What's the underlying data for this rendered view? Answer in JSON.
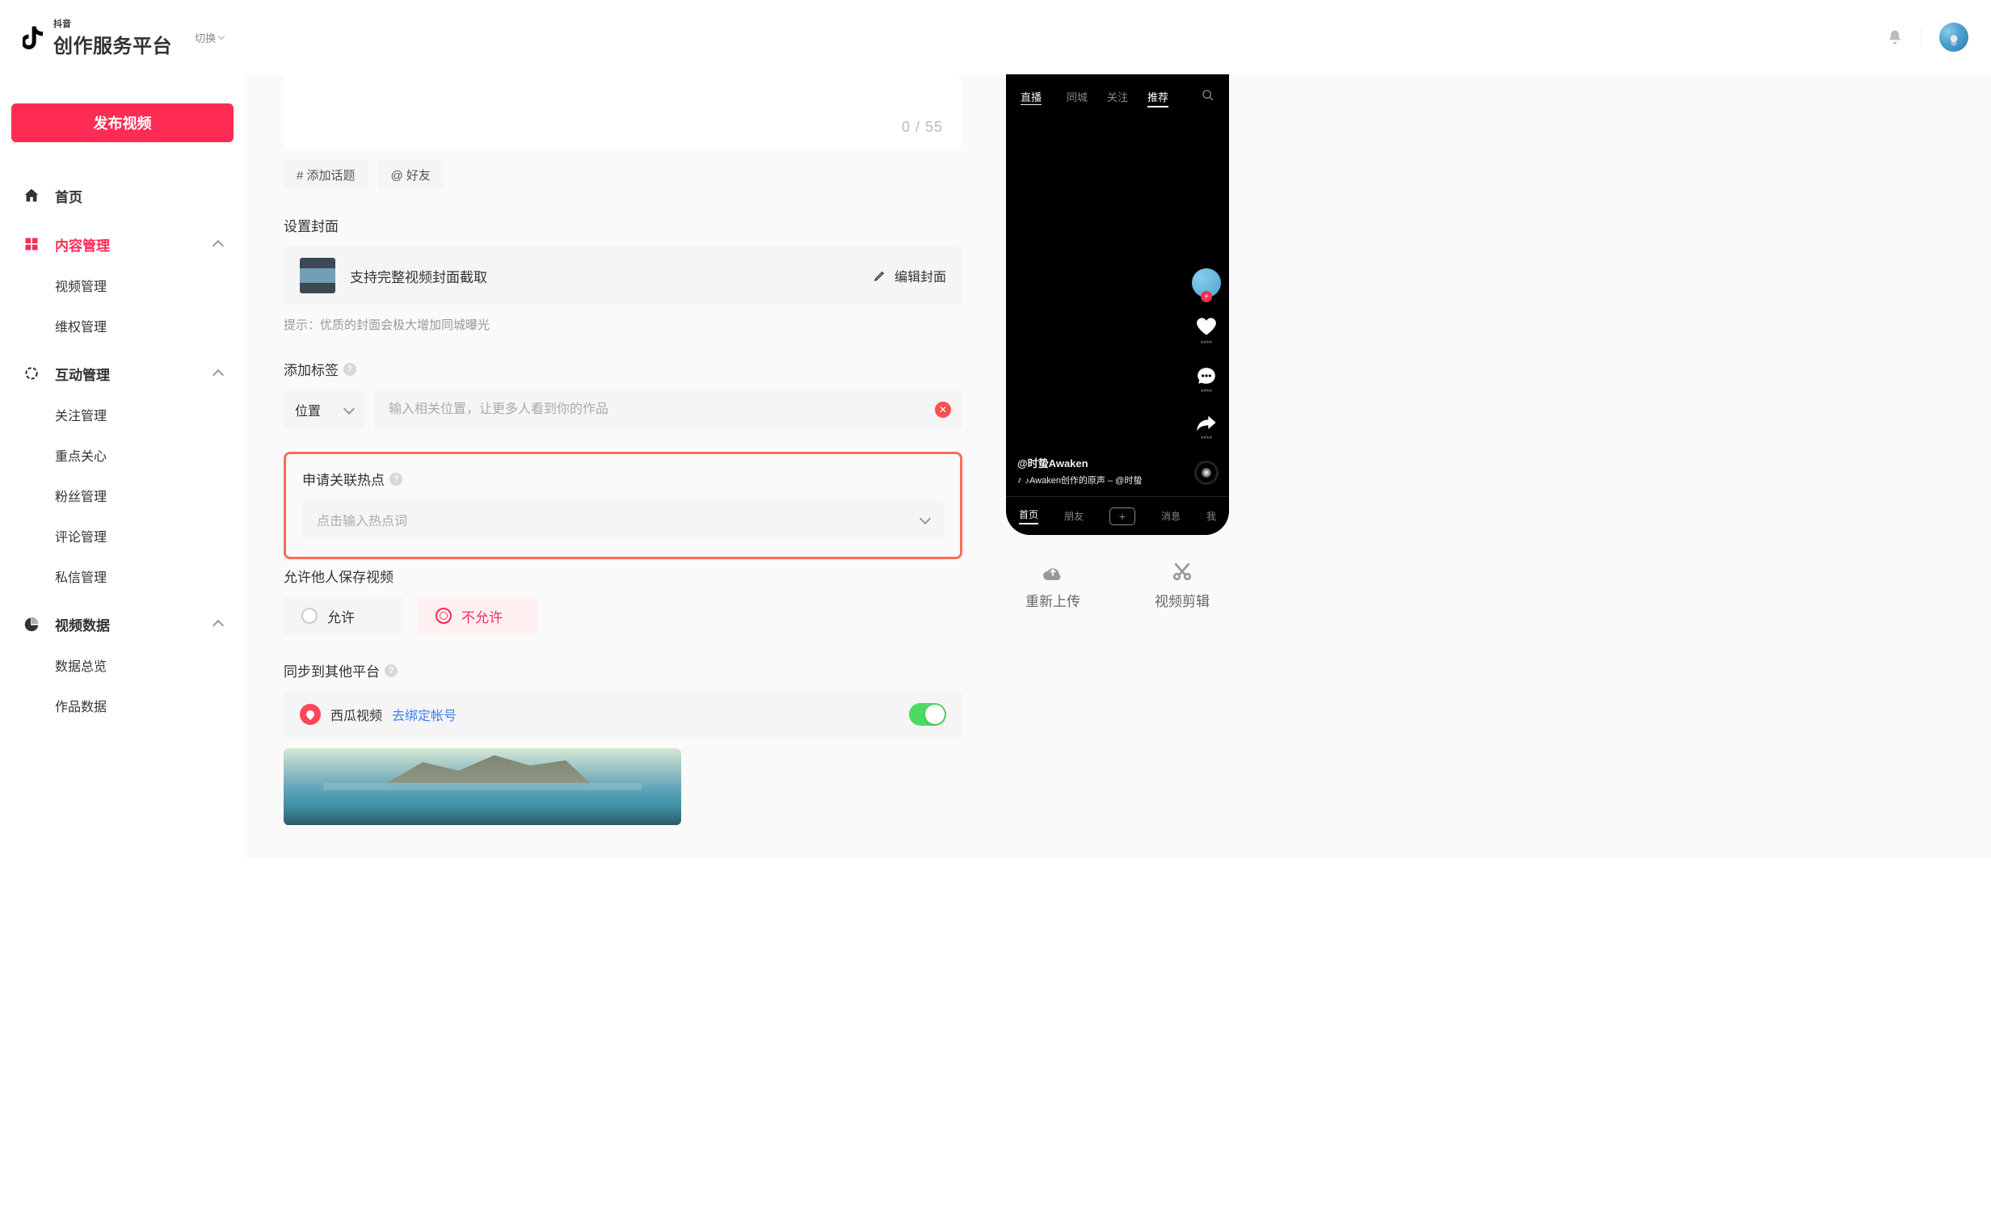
{
  "header": {
    "logo_small": "抖音",
    "logo_big": "创作服务平台",
    "switch": "切换"
  },
  "sidebar": {
    "publish": "发布视频",
    "home": "首页",
    "content": {
      "label": "内容管理",
      "items": [
        "视频管理",
        "维权管理"
      ]
    },
    "interact": {
      "label": "互动管理",
      "items": [
        "关注管理",
        "重点关心",
        "粉丝管理",
        "评论管理",
        "私信管理"
      ]
    },
    "data": {
      "label": "视频数据",
      "items": [
        "数据总览",
        "作品数据"
      ]
    }
  },
  "form": {
    "char_count": "0 / 55",
    "topic_btn": "# 添加话题",
    "mention_btn": "@ 好友",
    "cover": {
      "title": "设置封面",
      "desc": "支持完整视频封面截取",
      "edit": "编辑封面",
      "hint": "提示：优质的封面会极大增加同城曝光"
    },
    "tags": {
      "title": "添加标签",
      "select": "位置",
      "placeholder": "输入相关位置，让更多人看到你的作品"
    },
    "hotspot": {
      "title": "申请关联热点",
      "placeholder": "点击输入热点词"
    },
    "save_allow": {
      "title": "允许他人保存视频",
      "allow": "允许",
      "disallow": "不允许"
    },
    "sync": {
      "title": "同步到其他平台",
      "platform": "西瓜视频",
      "bind": "去绑定帐号"
    }
  },
  "phone": {
    "live": "直播",
    "tabs": [
      "同城",
      "关注",
      "推荐"
    ],
    "author": "@时蛰Awaken",
    "music": "♪Awaken创作的原声 – @时蛰",
    "bottom": [
      "首页",
      "朋友",
      "消息",
      "我"
    ]
  },
  "preview_actions": {
    "reupload": "重新上传",
    "edit": "视频剪辑"
  }
}
